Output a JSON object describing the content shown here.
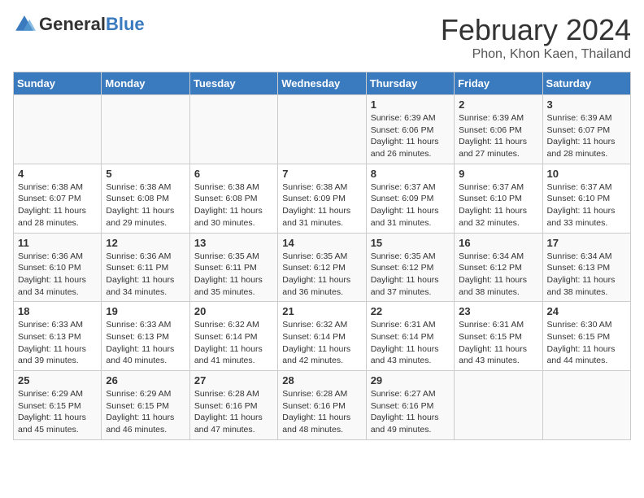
{
  "logo": {
    "general": "General",
    "blue": "Blue"
  },
  "title": "February 2024",
  "subtitle": "Phon, Khon Kaen, Thailand",
  "days_of_week": [
    "Sunday",
    "Monday",
    "Tuesday",
    "Wednesday",
    "Thursday",
    "Friday",
    "Saturday"
  ],
  "weeks": [
    [
      {
        "day": "",
        "info": ""
      },
      {
        "day": "",
        "info": ""
      },
      {
        "day": "",
        "info": ""
      },
      {
        "day": "",
        "info": ""
      },
      {
        "day": "1",
        "info": "Sunrise: 6:39 AM\nSunset: 6:06 PM\nDaylight: 11 hours and 26 minutes."
      },
      {
        "day": "2",
        "info": "Sunrise: 6:39 AM\nSunset: 6:06 PM\nDaylight: 11 hours and 27 minutes."
      },
      {
        "day": "3",
        "info": "Sunrise: 6:39 AM\nSunset: 6:07 PM\nDaylight: 11 hours and 28 minutes."
      }
    ],
    [
      {
        "day": "4",
        "info": "Sunrise: 6:38 AM\nSunset: 6:07 PM\nDaylight: 11 hours and 28 minutes."
      },
      {
        "day": "5",
        "info": "Sunrise: 6:38 AM\nSunset: 6:08 PM\nDaylight: 11 hours and 29 minutes."
      },
      {
        "day": "6",
        "info": "Sunrise: 6:38 AM\nSunset: 6:08 PM\nDaylight: 11 hours and 30 minutes."
      },
      {
        "day": "7",
        "info": "Sunrise: 6:38 AM\nSunset: 6:09 PM\nDaylight: 11 hours and 31 minutes."
      },
      {
        "day": "8",
        "info": "Sunrise: 6:37 AM\nSunset: 6:09 PM\nDaylight: 11 hours and 31 minutes."
      },
      {
        "day": "9",
        "info": "Sunrise: 6:37 AM\nSunset: 6:10 PM\nDaylight: 11 hours and 32 minutes."
      },
      {
        "day": "10",
        "info": "Sunrise: 6:37 AM\nSunset: 6:10 PM\nDaylight: 11 hours and 33 minutes."
      }
    ],
    [
      {
        "day": "11",
        "info": "Sunrise: 6:36 AM\nSunset: 6:10 PM\nDaylight: 11 hours and 34 minutes."
      },
      {
        "day": "12",
        "info": "Sunrise: 6:36 AM\nSunset: 6:11 PM\nDaylight: 11 hours and 34 minutes."
      },
      {
        "day": "13",
        "info": "Sunrise: 6:35 AM\nSunset: 6:11 PM\nDaylight: 11 hours and 35 minutes."
      },
      {
        "day": "14",
        "info": "Sunrise: 6:35 AM\nSunset: 6:12 PM\nDaylight: 11 hours and 36 minutes."
      },
      {
        "day": "15",
        "info": "Sunrise: 6:35 AM\nSunset: 6:12 PM\nDaylight: 11 hours and 37 minutes."
      },
      {
        "day": "16",
        "info": "Sunrise: 6:34 AM\nSunset: 6:12 PM\nDaylight: 11 hours and 38 minutes."
      },
      {
        "day": "17",
        "info": "Sunrise: 6:34 AM\nSunset: 6:13 PM\nDaylight: 11 hours and 38 minutes."
      }
    ],
    [
      {
        "day": "18",
        "info": "Sunrise: 6:33 AM\nSunset: 6:13 PM\nDaylight: 11 hours and 39 minutes."
      },
      {
        "day": "19",
        "info": "Sunrise: 6:33 AM\nSunset: 6:13 PM\nDaylight: 11 hours and 40 minutes."
      },
      {
        "day": "20",
        "info": "Sunrise: 6:32 AM\nSunset: 6:14 PM\nDaylight: 11 hours and 41 minutes."
      },
      {
        "day": "21",
        "info": "Sunrise: 6:32 AM\nSunset: 6:14 PM\nDaylight: 11 hours and 42 minutes."
      },
      {
        "day": "22",
        "info": "Sunrise: 6:31 AM\nSunset: 6:14 PM\nDaylight: 11 hours and 43 minutes."
      },
      {
        "day": "23",
        "info": "Sunrise: 6:31 AM\nSunset: 6:15 PM\nDaylight: 11 hours and 43 minutes."
      },
      {
        "day": "24",
        "info": "Sunrise: 6:30 AM\nSunset: 6:15 PM\nDaylight: 11 hours and 44 minutes."
      }
    ],
    [
      {
        "day": "25",
        "info": "Sunrise: 6:29 AM\nSunset: 6:15 PM\nDaylight: 11 hours and 45 minutes."
      },
      {
        "day": "26",
        "info": "Sunrise: 6:29 AM\nSunset: 6:15 PM\nDaylight: 11 hours and 46 minutes."
      },
      {
        "day": "27",
        "info": "Sunrise: 6:28 AM\nSunset: 6:16 PM\nDaylight: 11 hours and 47 minutes."
      },
      {
        "day": "28",
        "info": "Sunrise: 6:28 AM\nSunset: 6:16 PM\nDaylight: 11 hours and 48 minutes."
      },
      {
        "day": "29",
        "info": "Sunrise: 6:27 AM\nSunset: 6:16 PM\nDaylight: 11 hours and 49 minutes."
      },
      {
        "day": "",
        "info": ""
      },
      {
        "day": "",
        "info": ""
      }
    ]
  ]
}
